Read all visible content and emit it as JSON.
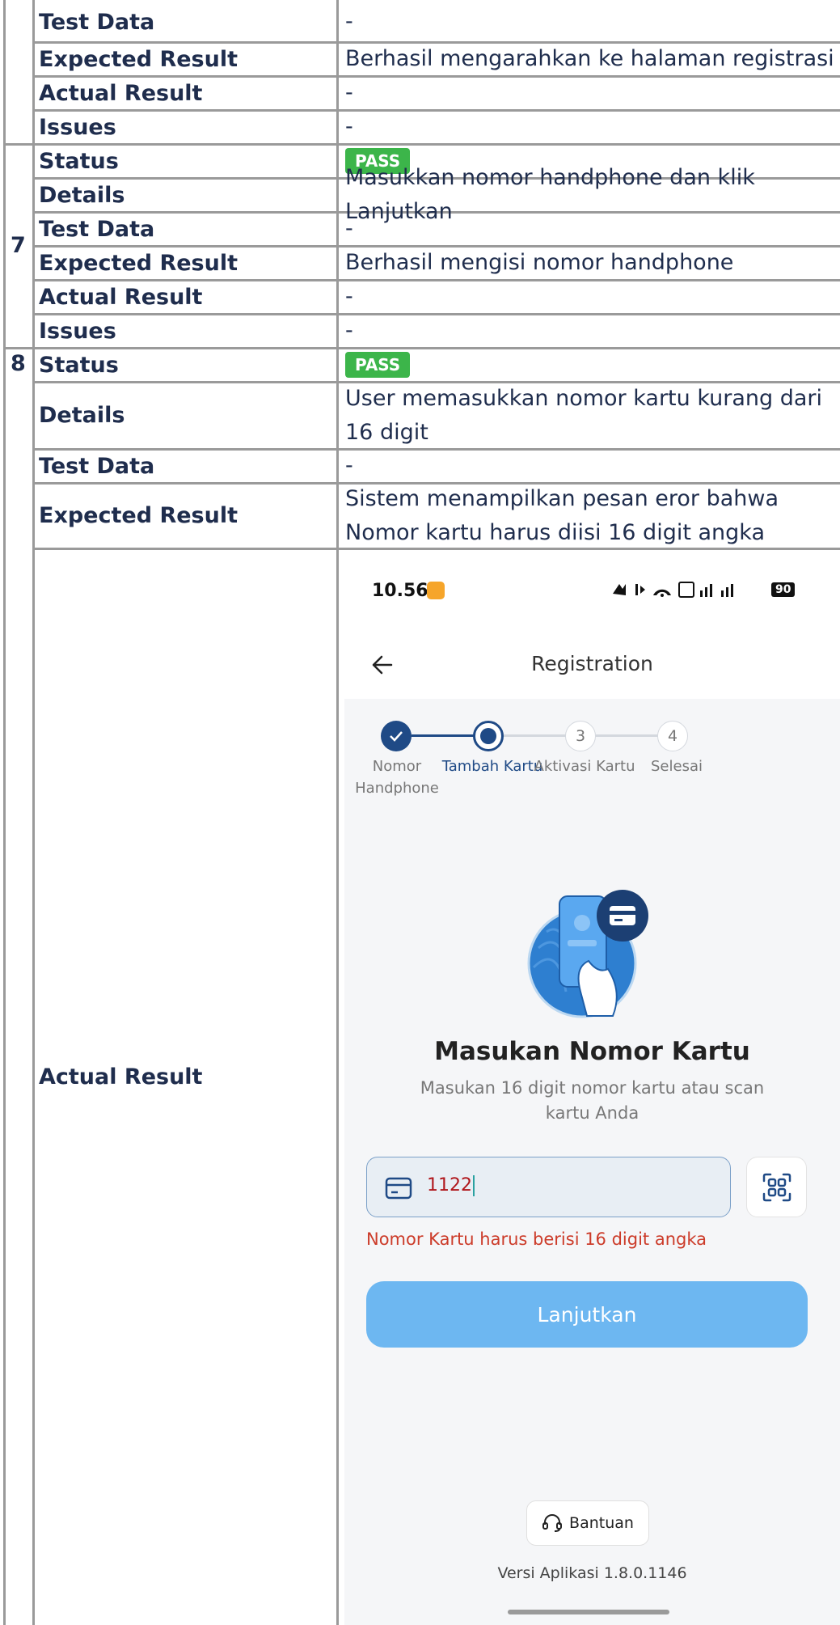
{
  "table": {
    "rows": [
      {
        "label": "Test Data",
        "value": "-"
      },
      {
        "label": "Expected Result",
        "value": "Berhasil mengarahkan ke halaman registrasi"
      },
      {
        "label": "Actual Result",
        "value": "-"
      },
      {
        "label": "Issues",
        "value": "-"
      }
    ],
    "case7": {
      "number": "7",
      "status_label": "Status",
      "status_badge": "PASS",
      "details_label": "Details",
      "details": "Masukkan nomor handphone dan klik Lanjutkan",
      "test_data_label": "Test Data",
      "test_data": "-",
      "expected_label": "Expected Result",
      "expected": "Berhasil mengisi nomor handphone",
      "actual_label": "Actual Result",
      "actual": "-",
      "issues_label": "Issues",
      "issues": "-"
    },
    "case8": {
      "number": "8",
      "status_label": "Status",
      "status_badge": "PASS",
      "details_label": "Details",
      "details": "User memasukkan nomor kartu kurang dari 16 digit",
      "test_data_label": "Test Data",
      "test_data": "-",
      "expected_label": "Expected Result",
      "expected": "Sistem menampilkan pesan eror bahwa Nomor kartu harus diisi 16 digit angka",
      "actual_label": "Actual Result"
    }
  },
  "phone": {
    "time": "10.56",
    "battery": "90",
    "title": "Registration",
    "steps": [
      {
        "number": "1",
        "label": "Nomor Handphone",
        "state": "done"
      },
      {
        "number": "2",
        "label": "Tambah Kartu",
        "state": "active"
      },
      {
        "number": "3",
        "label": "Aktivasi Kartu",
        "state": "pending"
      },
      {
        "number": "4",
        "label": "Selesai",
        "state": "pending"
      }
    ],
    "heading": "Masukan Nomor Kartu",
    "subtext": "Masukan 16 digit nomor kartu atau scan kartu Anda",
    "input_value": "1122",
    "error": "Nomor Kartu harus berisi 16 digit angka",
    "button": "Lanjutkan",
    "help": "Bantuan",
    "version": "Versi Aplikasi  1.8.0.1146"
  },
  "colors": {
    "pass": "#3cb54a",
    "primary": "#1f4a86",
    "button": "#6db7f1",
    "error": "#cc3b29"
  }
}
